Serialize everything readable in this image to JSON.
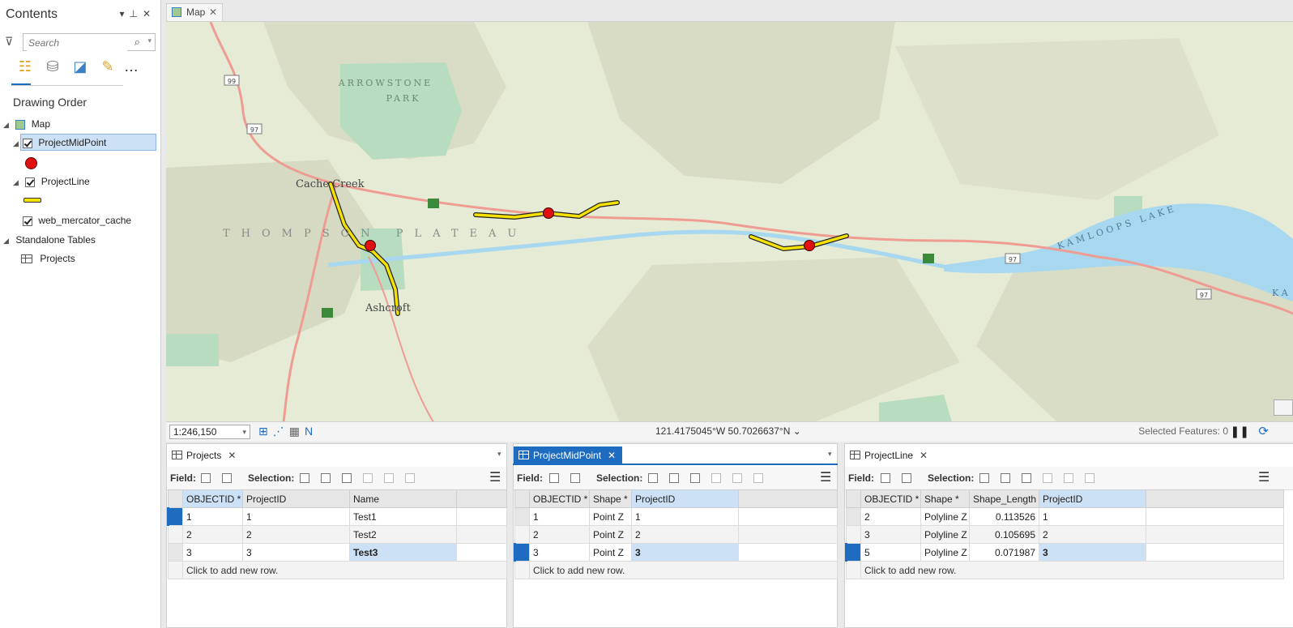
{
  "contents": {
    "title": "Contents",
    "search_placeholder": "Search",
    "drawing_order": "Drawing Order",
    "map_label": "Map",
    "layers": [
      {
        "name": "ProjectMidPoint"
      },
      {
        "name": "ProjectLine"
      },
      {
        "name": "web_mercator_cache"
      }
    ],
    "standalone_tables": "Standalone Tables",
    "tables": [
      "Projects"
    ]
  },
  "map": {
    "tab_label": "Map",
    "labels": {
      "arrowstone": "ARROWSTONE",
      "park": "PARK",
      "cache_creek": "Cache Creek",
      "thompson_plateau": "THOMPSON PLATEAU",
      "ashcroft": "Ashcroft",
      "kamloops_lake": "KAMLOOPS LAKE",
      "ka": "KA"
    },
    "shields": [
      "99",
      "97",
      "97",
      "97"
    ],
    "scale": "1:246,150",
    "coordinates": "121.4175045°W 50.7026637°N",
    "selected_features": "Selected Features: 0"
  },
  "colors": {
    "accent": "#1e6cc0",
    "point": "#e01010",
    "line_fill": "#f5e200",
    "road": "#ef9c93",
    "water": "#a8d8ef",
    "park": "#b7dcc0"
  },
  "tables": [
    {
      "tab": "Projects",
      "field_label": "Field:",
      "selection_label": "Selection:",
      "columns": [
        "OBJECTID *",
        "ProjectID",
        "Name"
      ],
      "rows": [
        [
          "1",
          "1",
          "Test1"
        ],
        [
          "2",
          "2",
          "Test2"
        ],
        [
          "3",
          "3",
          "Test3"
        ]
      ],
      "add_row": "Click to add new row."
    },
    {
      "tab": "ProjectMidPoint",
      "field_label": "Field:",
      "selection_label": "Selection:",
      "columns": [
        "OBJECTID *",
        "Shape *",
        "ProjectID"
      ],
      "rows": [
        [
          "1",
          "Point Z",
          "1"
        ],
        [
          "2",
          "Point Z",
          "2"
        ],
        [
          "3",
          "Point Z",
          "3"
        ]
      ],
      "add_row": "Click to add new row."
    },
    {
      "tab": "ProjectLine",
      "field_label": "Field:",
      "selection_label": "Selection:",
      "columns": [
        "OBJECTID *",
        "Shape *",
        "Shape_Length",
        "ProjectID"
      ],
      "rows": [
        [
          "2",
          "Polyline Z",
          "0.113526",
          "1"
        ],
        [
          "3",
          "Polyline Z",
          "0.105695",
          "2"
        ],
        [
          "5",
          "Polyline Z",
          "0.071987",
          "3"
        ]
      ],
      "add_row": "Click to add new row."
    }
  ]
}
